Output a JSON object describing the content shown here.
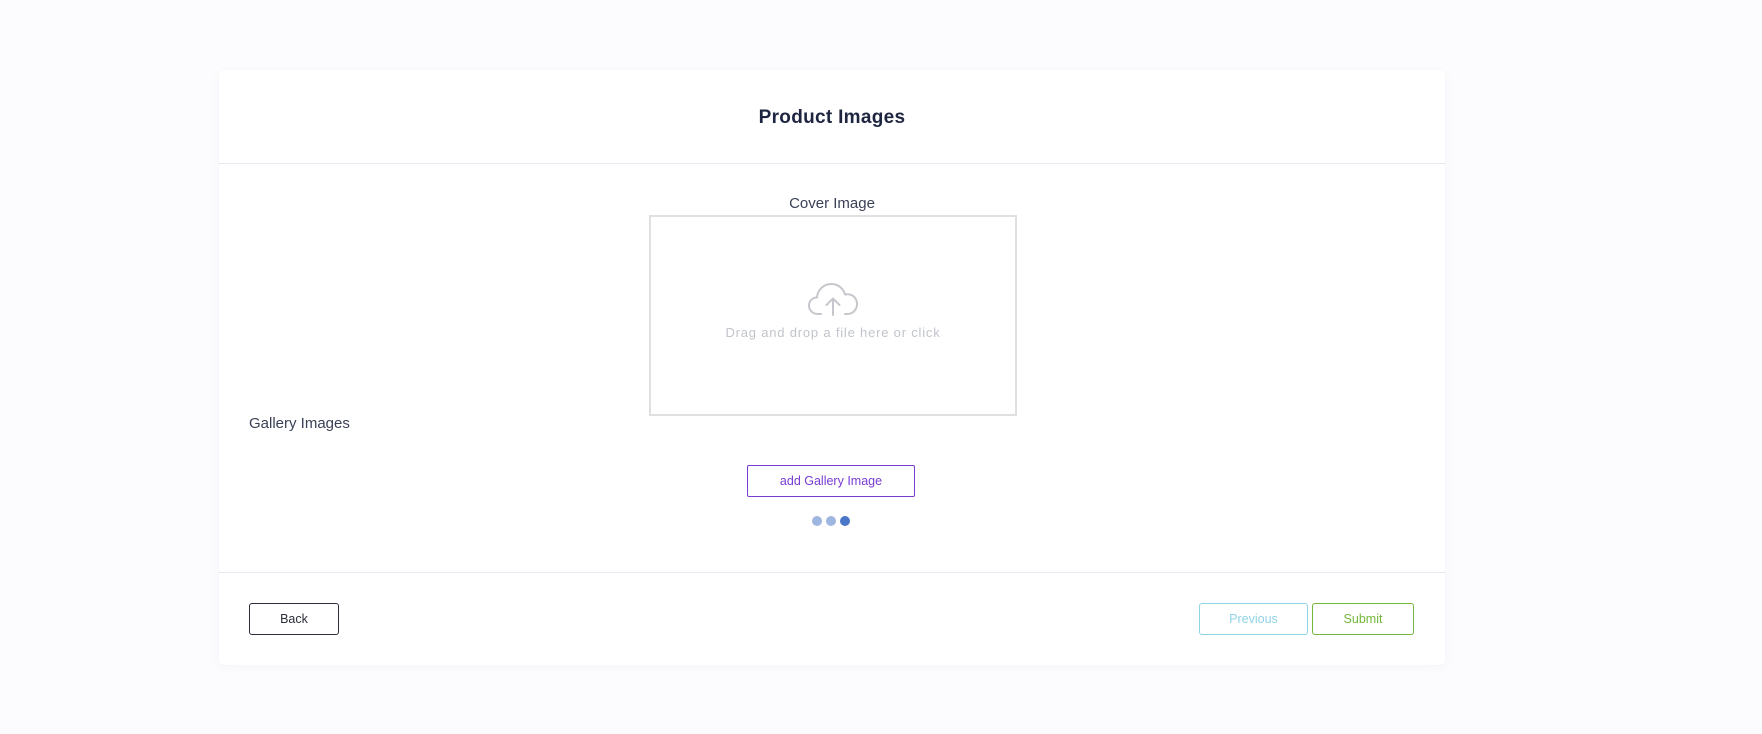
{
  "page": {
    "title": "Product Images"
  },
  "cover": {
    "label": "Cover Image",
    "dropzone_text": "Drag and drop a file here or click",
    "icon": "cloud-upload-icon"
  },
  "gallery": {
    "label": "Gallery Images",
    "add_button_label": "add Gallery Image"
  },
  "loader": {
    "dots": 3,
    "active_dot": 3
  },
  "footer": {
    "back_label": "Back",
    "previous_label": "Previous",
    "submit_label": "Submit"
  },
  "colors": {
    "accent_purple": "#7a3cd3",
    "previous": "#8fd3e6",
    "submit": "#74b73a",
    "loader_dot": "#9fb6e0",
    "loader_dot_active": "#4a77c7"
  }
}
